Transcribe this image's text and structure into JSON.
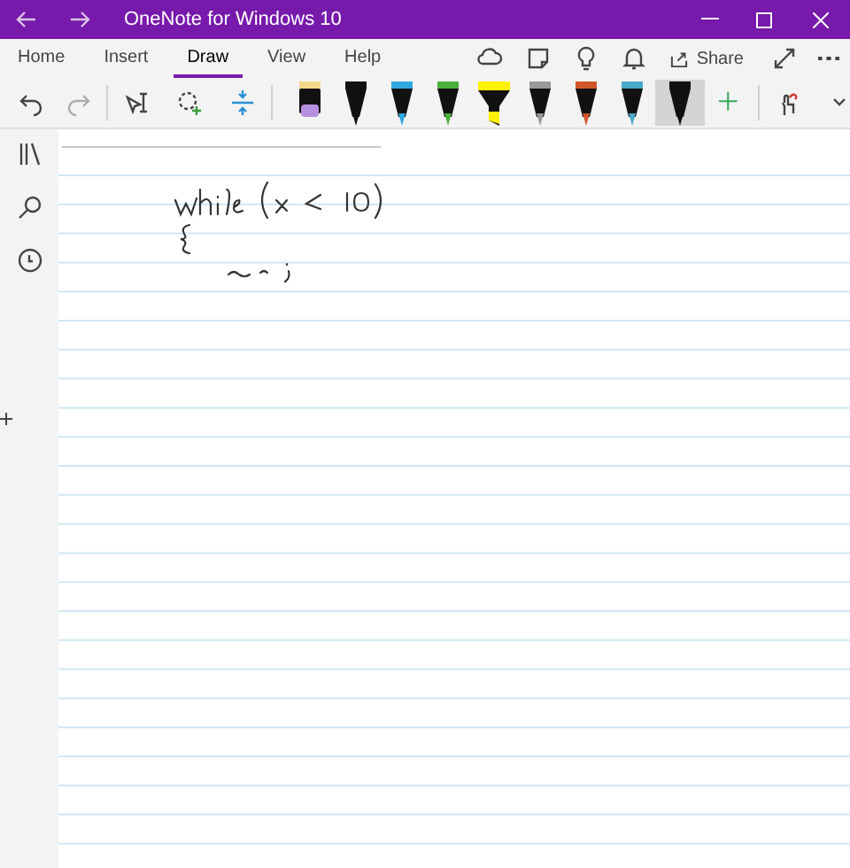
{
  "window": {
    "title": "OneNote for Windows 10"
  },
  "tabs": [
    {
      "label": "Home",
      "selected": false
    },
    {
      "label": "Insert",
      "selected": false
    },
    {
      "label": "Draw",
      "selected": true
    },
    {
      "label": "View",
      "selected": false
    },
    {
      "label": "Help",
      "selected": false
    }
  ],
  "share": {
    "label": "Share"
  },
  "pens": [
    {
      "kind": "marker",
      "color": "#b690e0",
      "selected": false
    },
    {
      "kind": "pen",
      "color": "#111111",
      "selected": false
    },
    {
      "kind": "pen",
      "color": "#2fa8e0",
      "selected": false
    },
    {
      "kind": "pen",
      "color": "#4caf3a",
      "selected": false
    },
    {
      "kind": "highlighter",
      "color": "#fff200",
      "selected": false
    },
    {
      "kind": "pen",
      "color": "#9a9a9a",
      "selected": false
    },
    {
      "kind": "pen",
      "color": "#d2572a",
      "selected": false
    },
    {
      "kind": "pen",
      "color": "#4aa8c8",
      "selected": false
    },
    {
      "kind": "pen",
      "color": "#111111",
      "selected": true
    }
  ]
}
